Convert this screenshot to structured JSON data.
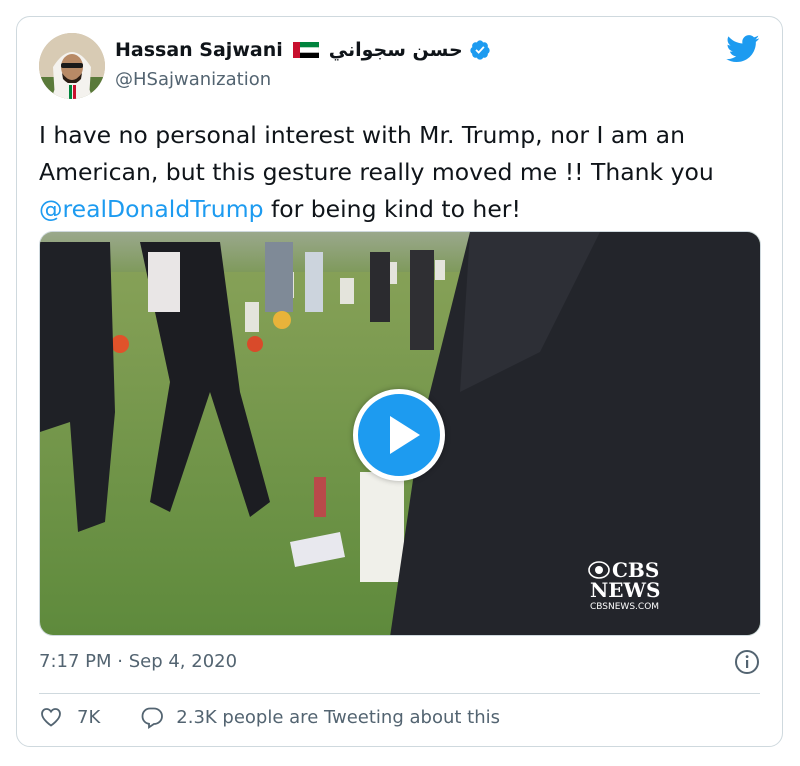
{
  "author": {
    "name": "Hassan Sajwani",
    "name_arabic": "حسن سجواني",
    "handle": "@HSajwanization",
    "verified": true,
    "flag_icon": "uae-flag-icon"
  },
  "tweet": {
    "text_part1": "I have no personal interest with Mr. Trump, nor I am an American, but this gesture really moved me !! Thank you ",
    "mention": "@realDonaldTrump",
    "text_part2": " for being kind to her!"
  },
  "media": {
    "type": "video",
    "watermark_line1": "CBS",
    "watermark_line2": "NEWS",
    "watermark_line3": "CBSNEWS.COM"
  },
  "meta": {
    "timestamp": "7:17 PM · Sep 4, 2020"
  },
  "actions": {
    "like_count": "7K",
    "reply_label": "2.3K people are Tweeting about this"
  },
  "colors": {
    "accent": "#1d9bf0",
    "text": "#0f1419",
    "secondary_text": "#536471",
    "border": "#cfd9de"
  }
}
